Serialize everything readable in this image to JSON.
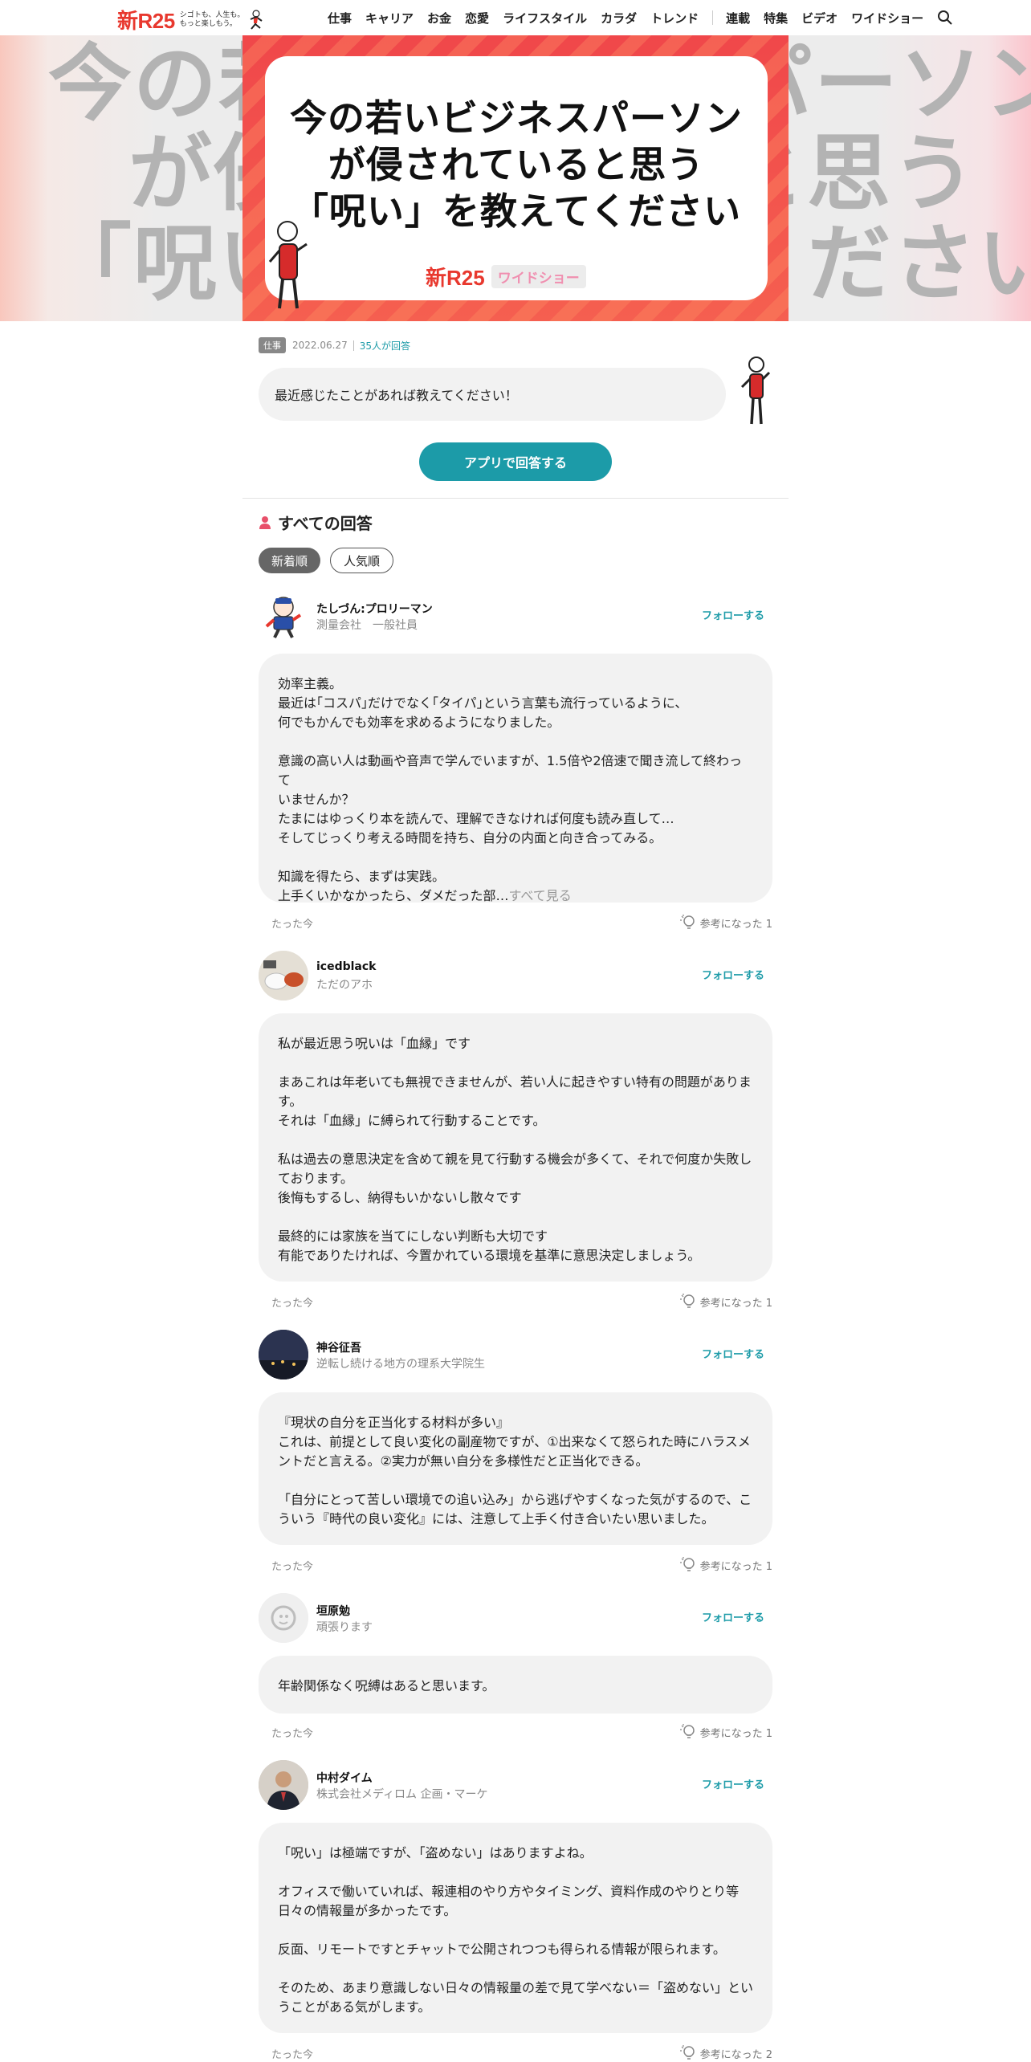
{
  "header": {
    "logo": "新R25",
    "tagline_1": "シゴトも、人生も。",
    "tagline_2": "もっと楽しもう。",
    "nav": [
      "仕事",
      "キャリア",
      "お金",
      "恋愛",
      "ライフスタイル",
      "カラダ",
      "トレンド"
    ],
    "nav_right": [
      "連載",
      "特集",
      "ビデオ",
      "ワイドショー"
    ]
  },
  "hero": {
    "title": "今の若いビジネスパーソン\nが侵されていると思う\n「呪い」を教えてください",
    "ghost_line1": "今の若いビジネスパーソン",
    "ghost_line2": "が侵されていると思う",
    "ghost_line3": "「呪い」を教えてください",
    "brand": "新R25",
    "brand_chip": "ワイドショー"
  },
  "meta": {
    "category": "仕事",
    "date": "2022.06.27",
    "count": "35人が回答"
  },
  "question": "最近感じたことがあれば教えてください！",
  "app_button": "アプリで回答する",
  "section_title": "すべての回答",
  "sort_tabs": [
    "新着順",
    "人気順"
  ],
  "answers": [
    {
      "name": "たしづん:プロリーマン",
      "role": "測量会社　一般社員",
      "follow": "フォローする",
      "body": "効率主義。\n最近は｢コスパ｣だけでなく｢タイパ｣という言葉も流行っているように、\n何でもかんでも効率を求めるようになりました。\n\n意識の高い人は動画や音声で学んでいますが、1.5倍や2倍速で聞き流して終わって\nいませんか？\nたまにはゆっくり本を読んで、理解できなければ何度も読み直して…\nそしてじっくり考える時間を持ち、自分の内面と向き合ってみる。\n\n知識を得たら、まずは実践。\n上手くいかなかったら、ダメだった部…",
      "see_all": "すべて見る",
      "time": "たった今",
      "helpful": "参考になった 1"
    },
    {
      "name": "icedblack",
      "role": "ただのアホ",
      "follow": "フォローする",
      "body": "私が最近思う呪いは「血縁」です\n\nまあこれは年老いても無視できませんが、若い人に起きやすい特有の問題がありま\nす。\nそれは「血縁」に縛られて行動することです。\n\n私は過去の意思決定を含めて親を見て行動する機会が多くて、それで何度か失敗し\nております。\n後悔もするし、納得もいかないし散々です\n\n最終的には家族を当てにしない判断も大切です\n有能でありたければ、今置かれている環境を基準に意思決定しましょう。",
      "time": "たった今",
      "helpful": "参考になった 1"
    },
    {
      "name": "神谷征吾",
      "role": "逆転し続ける地方の理系大学院生",
      "follow": "フォローする",
      "body": "『現状の自分を正当化する材料が多い』\nこれは、前提として良い変化の副産物ですが、①出来なくて怒られた時にハラスメ\nントだと言える。②実力が無い自分を多様性だと正当化できる。\n\n「自分にとって苦しい環境での追い込み」から逃げやすくなった気がするので、こ\nういう『時代の良い変化』には、注意して上手く付き合いたい思いました。",
      "time": "たった今",
      "helpful": "参考になった 1"
    },
    {
      "name": "垣原勉",
      "role": "頑張ります",
      "follow": "フォローする",
      "body": "年齢関係なく呪縛はあると思います。",
      "time": "たった今",
      "helpful": "参考になった 1"
    },
    {
      "name": "中村ダイム",
      "role": "株式会社メディロム 企画・マーケ",
      "follow": "フォローする",
      "body": "「呪い」は極端ですが、「盗めない」はありますよね。\n\nオフィスで働いていれば、報連相のやり方やタイミング、資料作成のやりとり等\n日々の情報量が多かったです。\n\n反面、リモートですとチャットで公開されつつも得られる情報が限られます。\n\nそのため、あまり意識しない日々の情報量の差で見て学べない＝「盗めない」とい\nうことがある気がします。",
      "time": "たった今",
      "helpful": "参考になった 2"
    }
  ],
  "colors": {
    "brand_red": "#e8382e",
    "accent_teal": "#1c9ba8",
    "bubble_gray": "#f2f2f2"
  }
}
